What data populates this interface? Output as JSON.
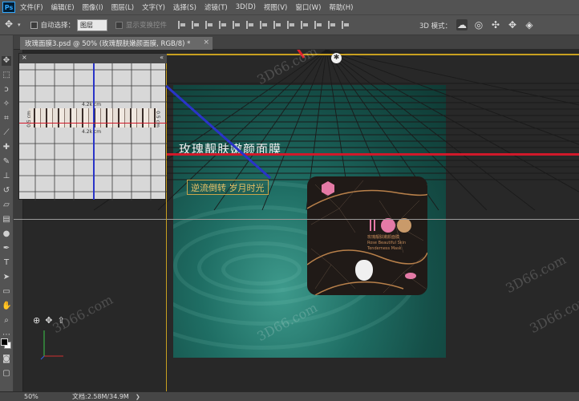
{
  "menubar": {
    "logo": "Ps",
    "items": [
      "文件(F)",
      "编辑(E)",
      "图像(I)",
      "图层(L)",
      "文字(Y)",
      "选择(S)",
      "滤镜(T)",
      "3D(D)",
      "视图(V)",
      "窗口(W)",
      "帮助(H)"
    ]
  },
  "options": {
    "auto_select_label": "自动选择：",
    "auto_select_value": "图层",
    "show_transform_label": "显示变换控件",
    "mode_label": "3D 模式："
  },
  "document": {
    "tab_title": "玫瑰面膜3.psd @ 50% (玫瑰靓肤嫩颜面膜, RGB/8) *",
    "close": "×"
  },
  "artwork": {
    "title": "玫瑰靓肤嫩颜面膜",
    "slogan": "逆流倒转  岁月时光",
    "product_text_line1": "玫瑰靓肤嫩颜面膜",
    "product_text_line2": "Rose Beautiful Skin",
    "product_text_line3": "Tenderness Mask"
  },
  "navigator": {
    "measure_top": "4.2k cm",
    "measure_bottom": "4.2k cm",
    "measure_left": "0.5 cm",
    "measure_right": "0.5 cm"
  },
  "watermarks": [
    "3D66.com",
    "3D66.com",
    "3D66.com",
    "3D66.com",
    "3D66.com"
  ],
  "status": {
    "zoom": "50%",
    "doc_size": "文档:2.58M/34.9M",
    "arrow": "❯"
  },
  "colors": {
    "guide_red": "#d0192a",
    "guide_blue": "#2a34c8",
    "frame_yellow": "#c8a020",
    "accent_gold": "#e6c066"
  }
}
